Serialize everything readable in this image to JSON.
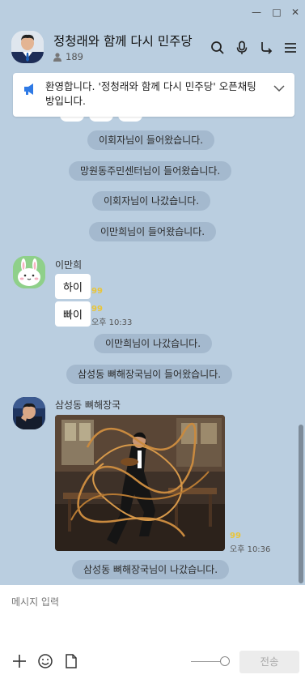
{
  "window": {
    "minimize": "—",
    "maximize": "□",
    "close": "✕"
  },
  "room": {
    "title": "정청래와 함께 다시 민주당",
    "member_count": "189"
  },
  "icons": {
    "search": "search-icon",
    "mic": "mic-icon",
    "share": "share-icon",
    "menu": "menu-icon",
    "notice": "megaphone-icon",
    "chevron": "chevron-down-icon",
    "plus": "plus-icon",
    "emoji": "emoji-icon",
    "file": "file-icon"
  },
  "notice": {
    "text": "환영합니다. '정청래와 함께 다시 민주당' 오픈채팅방입니다."
  },
  "messages": {
    "sys1": "이회자님이 들어왔습니다.",
    "sys2": "망원동주민센터님이 들어왔습니다.",
    "sys3": "이회자님이 나갔습니다.",
    "sys4": "이만희님이 들어왔습니다.",
    "user1": {
      "name": "이만희",
      "msg1": "하이",
      "msg1_unread": "99",
      "msg2": "빠이",
      "msg2_unread": "99",
      "msg2_time": "오후 10:33"
    },
    "sys5": "이만희님이 나갔습니다.",
    "sys6": "삼성동 뼈해장국님이 들어왔습니다.",
    "user2": {
      "name": "삼성동 뼈해장국",
      "photo_unread": "99",
      "photo_time": "오후 10:36"
    },
    "sys7": "삼성동 뼈해장국님이 나갔습니다."
  },
  "composer": {
    "placeholder": "메시지 입력",
    "send_label": "전송"
  },
  "colors": {
    "background": "#bacee0",
    "unread": "#e8c53a",
    "notice_icon": "#2f7ae5"
  }
}
